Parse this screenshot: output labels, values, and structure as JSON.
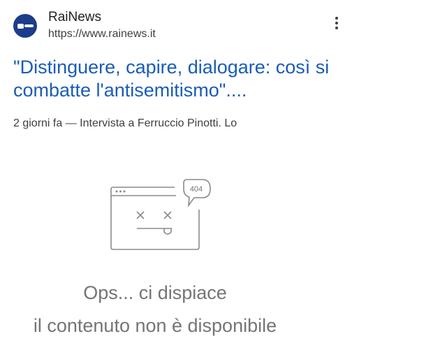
{
  "result": {
    "site_name": "RaiNews",
    "url": "https://www.rainews.it",
    "title": "\"Distinguere, capire, dialogare: così si combatte l'antisemitismo\"....",
    "snippet": "2 giorni fa — Intervista a Ferruccio Pinotti. Lo",
    "favicon_color": "#1d3c8a",
    "title_color": "#1a5cb8",
    "more_icon": "more-vert-icon"
  },
  "error_panel": {
    "bubble_code": "404",
    "message_line1": "Ops... ci dispiace",
    "message_line2": "il contenuto non è disponibile",
    "illustration_icon": "broken-browser-window-icon"
  }
}
